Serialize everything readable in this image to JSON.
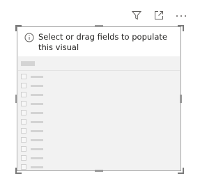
{
  "header": {
    "icons": [
      "filter-icon",
      "focus-mode-icon",
      "more-options-icon"
    ]
  },
  "visual": {
    "placeholder_icon": "info-icon",
    "placeholder_text_line1": "Select or drag fields to populate",
    "placeholder_text_line2": "this visual"
  },
  "colors": {
    "border": "#9a9a9a",
    "placeholder_bg": "#f2f2f2",
    "text": "#252423"
  }
}
